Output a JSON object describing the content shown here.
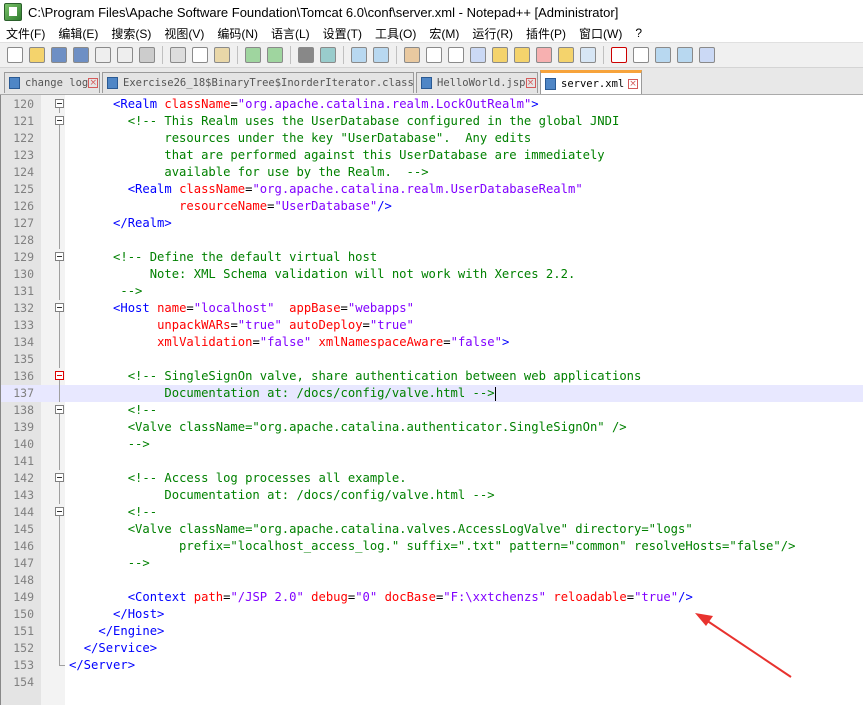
{
  "window": {
    "title": "C:\\Program Files\\Apache Software Foundation\\Tomcat 6.0\\conf\\server.xml - Notepad++ [Administrator]"
  },
  "menu": [
    "文件(F)",
    "编辑(E)",
    "搜索(S)",
    "视图(V)",
    "编码(N)",
    "语言(L)",
    "设置(T)",
    "工具(O)",
    "宏(M)",
    "运行(R)",
    "插件(P)",
    "窗口(W)",
    "?"
  ],
  "tabs": [
    {
      "label": "change log",
      "active": false
    },
    {
      "label": "Exercise26_18$BinaryTree$InorderIterator.class",
      "active": false
    },
    {
      "label": "HelloWorld.jsp",
      "active": false
    },
    {
      "label": "server.xml",
      "active": true
    }
  ],
  "lines": [
    {
      "n": "120",
      "fold": "box",
      "segs": [
        [
          "p",
          "      "
        ],
        [
          "t",
          "<Realm "
        ],
        [
          "a",
          "className"
        ],
        [
          "p",
          "="
        ],
        [
          "v",
          "\"org.apache.catalina.realm.LockOutRealm\""
        ],
        [
          "t",
          ">"
        ]
      ]
    },
    {
      "n": "121",
      "fold": "box",
      "segs": [
        [
          "p",
          "        "
        ],
        [
          "c",
          "<!-- This Realm uses the UserDatabase configured in the global JNDI"
        ]
      ]
    },
    {
      "n": "122",
      "fold": "line",
      "segs": [
        [
          "c",
          "             resources under the key \"UserDatabase\".  Any edits"
        ]
      ]
    },
    {
      "n": "123",
      "fold": "line",
      "segs": [
        [
          "c",
          "             that are performed against this UserDatabase are immediately"
        ]
      ]
    },
    {
      "n": "124",
      "fold": "line",
      "segs": [
        [
          "c",
          "             available for use by the Realm.  -->"
        ]
      ]
    },
    {
      "n": "125",
      "fold": "line",
      "segs": [
        [
          "p",
          "        "
        ],
        [
          "t",
          "<Realm "
        ],
        [
          "a",
          "className"
        ],
        [
          "p",
          "="
        ],
        [
          "v",
          "\"org.apache.catalina.realm.UserDatabaseRealm\""
        ]
      ]
    },
    {
      "n": "126",
      "fold": "line",
      "segs": [
        [
          "p",
          "               "
        ],
        [
          "a",
          "resourceName"
        ],
        [
          "p",
          "="
        ],
        [
          "v",
          "\"UserDatabase\""
        ],
        [
          "t",
          "/>"
        ]
      ]
    },
    {
      "n": "127",
      "fold": "line",
      "segs": [
        [
          "p",
          "      "
        ],
        [
          "t",
          "</Realm>"
        ]
      ]
    },
    {
      "n": "128",
      "fold": "line",
      "segs": []
    },
    {
      "n": "129",
      "fold": "box",
      "segs": [
        [
          "p",
          "      "
        ],
        [
          "c",
          "<!-- Define the default virtual host"
        ]
      ]
    },
    {
      "n": "130",
      "fold": "line",
      "segs": [
        [
          "c",
          "           Note: XML Schema validation will not work with Xerces 2.2."
        ]
      ]
    },
    {
      "n": "131",
      "fold": "line",
      "segs": [
        [
          "c",
          "       -->"
        ]
      ]
    },
    {
      "n": "132",
      "fold": "box",
      "segs": [
        [
          "p",
          "      "
        ],
        [
          "t",
          "<Host "
        ],
        [
          "a",
          "name"
        ],
        [
          "p",
          "="
        ],
        [
          "v",
          "\"localhost\""
        ],
        [
          "p",
          "  "
        ],
        [
          "a",
          "appBase"
        ],
        [
          "p",
          "="
        ],
        [
          "v",
          "\"webapps\""
        ]
      ]
    },
    {
      "n": "133",
      "fold": "line",
      "segs": [
        [
          "p",
          "            "
        ],
        [
          "a",
          "unpackWARs"
        ],
        [
          "p",
          "="
        ],
        [
          "v",
          "\"true\""
        ],
        [
          "p",
          " "
        ],
        [
          "a",
          "autoDeploy"
        ],
        [
          "p",
          "="
        ],
        [
          "v",
          "\"true\""
        ]
      ]
    },
    {
      "n": "134",
      "fold": "line",
      "segs": [
        [
          "p",
          "            "
        ],
        [
          "a",
          "xmlValidation"
        ],
        [
          "p",
          "="
        ],
        [
          "v",
          "\"false\""
        ],
        [
          "p",
          " "
        ],
        [
          "a",
          "xmlNamespaceAware"
        ],
        [
          "p",
          "="
        ],
        [
          "v",
          "\"false\""
        ],
        [
          "t",
          ">"
        ]
      ]
    },
    {
      "n": "135",
      "fold": "line",
      "segs": []
    },
    {
      "n": "136",
      "fold": "redbox",
      "segs": [
        [
          "p",
          "        "
        ],
        [
          "c",
          "<!-- SingleSignOn valve, share authentication between web applications"
        ]
      ]
    },
    {
      "n": "137",
      "fold": "line",
      "current": true,
      "segs": [
        [
          "c",
          "             Documentation at: /docs/config/valve.html -->"
        ]
      ]
    },
    {
      "n": "138",
      "fold": "box",
      "segs": [
        [
          "p",
          "        "
        ],
        [
          "c",
          "<!--"
        ]
      ]
    },
    {
      "n": "139",
      "fold": "line",
      "segs": [
        [
          "c",
          "        <Valve className=\"org.apache.catalina.authenticator.SingleSignOn\" />"
        ]
      ]
    },
    {
      "n": "140",
      "fold": "line",
      "segs": [
        [
          "c",
          "        -->"
        ]
      ]
    },
    {
      "n": "141",
      "fold": "line",
      "segs": []
    },
    {
      "n": "142",
      "fold": "box",
      "segs": [
        [
          "p",
          "        "
        ],
        [
          "c",
          "<!-- Access log processes all example."
        ]
      ]
    },
    {
      "n": "143",
      "fold": "line",
      "segs": [
        [
          "c",
          "             Documentation at: /docs/config/valve.html -->"
        ]
      ]
    },
    {
      "n": "144",
      "fold": "box",
      "segs": [
        [
          "p",
          "        "
        ],
        [
          "c",
          "<!--"
        ]
      ]
    },
    {
      "n": "145",
      "fold": "line",
      "segs": [
        [
          "c",
          "        <Valve className=\"org.apache.catalina.valves.AccessLogValve\" directory=\"logs\""
        ]
      ]
    },
    {
      "n": "146",
      "fold": "line",
      "segs": [
        [
          "c",
          "               prefix=\"localhost_access_log.\" suffix=\".txt\" pattern=\"common\" resolveHosts=\"false\"/>"
        ]
      ]
    },
    {
      "n": "147",
      "fold": "line",
      "segs": [
        [
          "c",
          "        -->"
        ]
      ]
    },
    {
      "n": "148",
      "fold": "line",
      "segs": []
    },
    {
      "n": "149",
      "fold": "line",
      "segs": [
        [
          "p",
          "        "
        ],
        [
          "t",
          "<Context "
        ],
        [
          "a",
          "path"
        ],
        [
          "p",
          "="
        ],
        [
          "v",
          "\"/JSP 2.0\""
        ],
        [
          "p",
          " "
        ],
        [
          "a",
          "debug"
        ],
        [
          "p",
          "="
        ],
        [
          "v",
          "\"0\""
        ],
        [
          "p",
          " "
        ],
        [
          "a",
          "docBase"
        ],
        [
          "p",
          "="
        ],
        [
          "v",
          "\"F:\\xxtchenzs\""
        ],
        [
          "p",
          " "
        ],
        [
          "a",
          "reloadable"
        ],
        [
          "p",
          "="
        ],
        [
          "v",
          "\"true\""
        ],
        [
          "t",
          "/>"
        ]
      ]
    },
    {
      "n": "150",
      "fold": "line",
      "segs": [
        [
          "p",
          "      "
        ],
        [
          "t",
          "</Host>"
        ]
      ]
    },
    {
      "n": "151",
      "fold": "line",
      "segs": [
        [
          "p",
          "    "
        ],
        [
          "t",
          "</Engine>"
        ]
      ]
    },
    {
      "n": "152",
      "fold": "line",
      "segs": [
        [
          "p",
          "  "
        ],
        [
          "t",
          "</Service>"
        ]
      ]
    },
    {
      "n": "153",
      "fold": "end",
      "segs": [
        [
          "t",
          "</Server>"
        ]
      ]
    },
    {
      "n": "154",
      "fold": "none",
      "segs": []
    }
  ]
}
